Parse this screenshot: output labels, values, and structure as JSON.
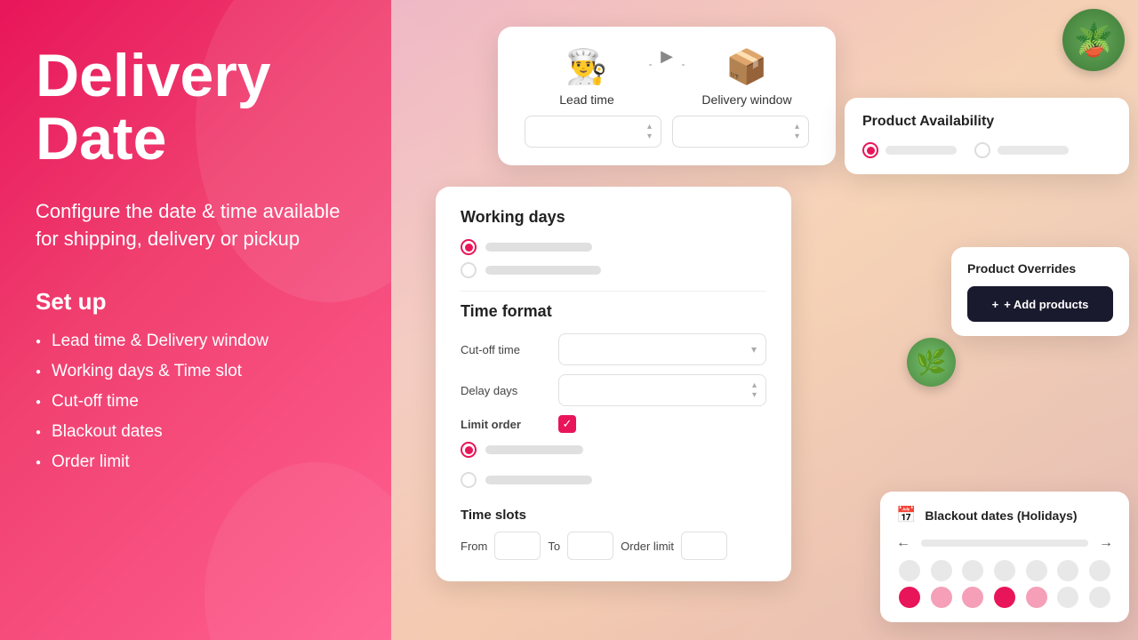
{
  "left": {
    "title_line1": "Delivery",
    "title_line2": "Date",
    "subtitle": "Configure the date & time available for shipping, delivery or pickup",
    "setup_heading": "Set up",
    "setup_items": [
      "Lead time & Delivery window",
      "Working days & Time slot",
      "Cut-off time",
      "Blackout dates",
      "Order limit"
    ]
  },
  "lead_time_card": {
    "icon1": "👨‍🍳",
    "icon2": "📦",
    "label1": "Lead time",
    "label2": "Delivery window",
    "select1_placeholder": "",
    "select2_placeholder": ""
  },
  "working_days_card": {
    "section1_title": "Working days",
    "section2_title": "Time format",
    "cutoff_label": "Cut-off time",
    "delay_label": "Delay days",
    "limit_label": "Limit order",
    "time_slots_title": "Time slots",
    "from_label": "From",
    "to_label": "To",
    "order_limit_label": "Order limit"
  },
  "product_availability_card": {
    "title": "Product Availability"
  },
  "product_overrides_card": {
    "title": "Product Overrides",
    "button_label": "+ Add products"
  },
  "blackout_card": {
    "title": "Blackout dates (Holidays)",
    "calendar_icon": "📅"
  },
  "icons": {
    "arrow_right": "▶",
    "chevron_down": "▾",
    "chevron_up": "▴",
    "arrow_left": "←",
    "arrow_right_nav": "→",
    "checkmark": "✓",
    "plus": "+"
  }
}
